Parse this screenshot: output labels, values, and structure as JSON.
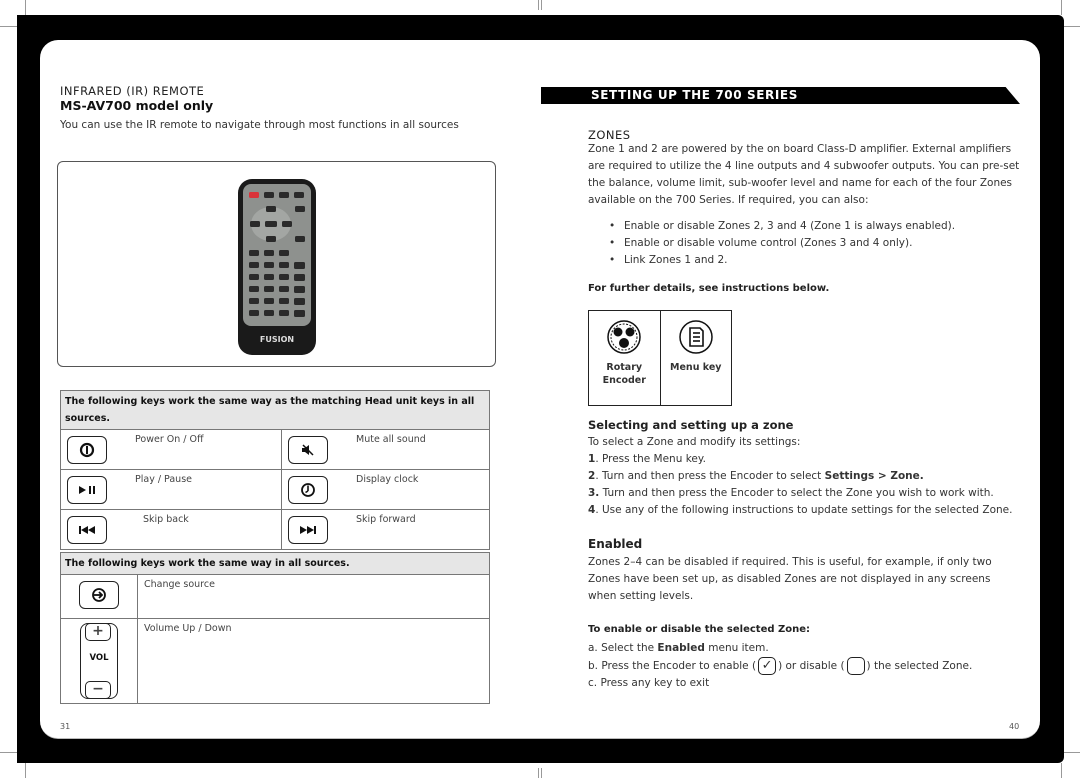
{
  "left_page": {
    "section_label": "INFRARED (IR) REMOTE",
    "model_heading": "MS-AV700 model only",
    "intro": "You can use the IR remote to navigate through most functions in all sources",
    "remote_image": {
      "brand_label": "FUSION",
      "alt": "IR remote control"
    },
    "head_unit_table": {
      "header": "The following keys work the same way as the matching Head unit keys in all sources.",
      "rows": [
        [
          {
            "icon": "power-icon",
            "label": "Power On / Off"
          },
          {
            "icon": "mute-icon",
            "label": "Mute all sound"
          }
        ],
        [
          {
            "icon": "play-pause-icon",
            "label": "Play / Pause"
          },
          {
            "icon": "clock-icon",
            "label": "Display clock"
          }
        ],
        [
          {
            "icon": "skip-back-icon",
            "label": "Skip back"
          },
          {
            "icon": "skip-forward-icon",
            "label": "Skip forward"
          }
        ]
      ]
    },
    "all_sources_table": {
      "header": "The following keys work the same way in all sources.",
      "rows": [
        {
          "icon": "source-icon",
          "label": "Change source"
        },
        {
          "icon": "volume-icon",
          "label": "Volume Up / Down",
          "vol_text": "VOL",
          "plus": "+",
          "minus": "−"
        }
      ]
    },
    "page_number": "31"
  },
  "right_page": {
    "banner": "SETTING UP THE 700 SERIES",
    "zones_label": "ZONES",
    "zones_paragraph": "Zone 1 and 2 are powered by the on board Class-D amplifier. External amplifiers are required to utilize the 4 line outputs and 4 subwoofer outputs. You can pre-set the balance, volume limit, sub-woofer level and name for each of the four Zones available on the 700 Series. If required, you can also:",
    "bullets": [
      "Enable or disable Zones 2, 3 and 4 (Zone 1 is always enabled).",
      "Enable or disable volume control (Zones 3 and 4 only).",
      "Link Zones 1 and 2."
    ],
    "further_details": "For further details, see instructions below.",
    "controls": [
      {
        "icon": "rotary-encoder-icon",
        "label_line1": "Rotary",
        "label_line2": "Encoder"
      },
      {
        "icon": "menu-key-icon",
        "label_line1": "Menu key",
        "label_line2": ""
      }
    ],
    "selecting_heading": "Selecting and setting up a zone",
    "selecting_intro": "To select a Zone and modify its settings:",
    "steps": [
      {
        "num": "1",
        "text": ". Press the Menu key.",
        "bold": "",
        "tail": ""
      },
      {
        "num": "2",
        "text": ". Turn and then press the Encoder to select ",
        "bold": "Settings > Zone.",
        "tail": ""
      },
      {
        "num": "3.",
        "text": " Turn and then press the Encoder to select the Zone you wish to work with.",
        "bold": "",
        "tail": ""
      },
      {
        "num": "4",
        "text": ". Use any of the following instructions to update settings for the selected Zone.",
        "bold": "",
        "tail": ""
      }
    ],
    "enabled_heading": "Enabled",
    "enabled_paragraph": "Zones 2–4 can be disabled if required. This is useful, for example, if only two Zones have been set up, as disabled Zones are not displayed in any screens when setting levels.",
    "toggle_heading": "To enable or disable the selected Zone:",
    "toggle_steps": {
      "a_prefix": "a.  Select the ",
      "a_bold": "Enabled",
      "a_suffix": " menu item.",
      "b_prefix": "b.  Press the Encoder to enable (",
      "b_mid": ") or disable (",
      "b_suffix": ") the selected Zone.",
      "checked_glyph": "✓",
      "c": "c.  Press any key to exit"
    },
    "page_number": "40"
  }
}
